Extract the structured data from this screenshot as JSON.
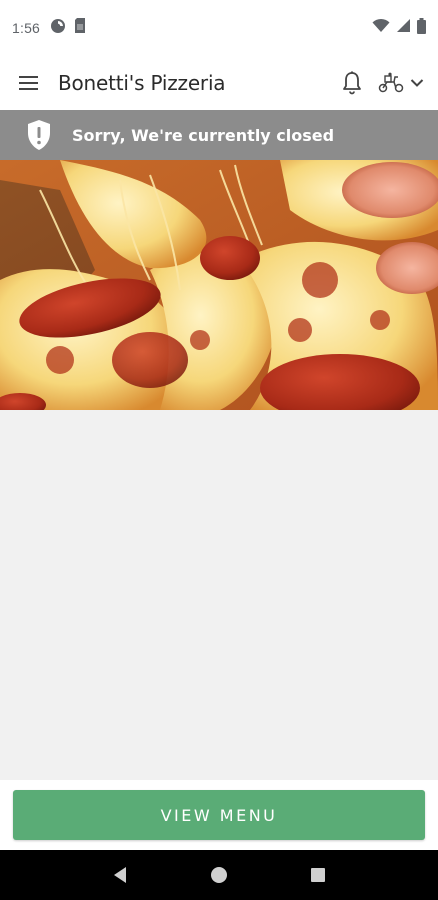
{
  "status_bar": {
    "time": "1:56",
    "left_icons": [
      "data-saver-icon",
      "sim-card-icon"
    ],
    "right_icons": [
      "wifi-icon",
      "cellular-signal-icon",
      "battery-icon"
    ]
  },
  "app_bar": {
    "title": "Bonetti's Pizzeria",
    "icons": [
      "menu-icon",
      "bell-icon",
      "delivery-scooter-icon",
      "chevron-down-icon"
    ]
  },
  "closed_banner": {
    "icon": "shield-alert-icon",
    "text": "Sorry, We're currently closed",
    "background": "#8c8c8c"
  },
  "hero_image": {
    "subject": "pizza-photo"
  },
  "bottom": {
    "view_menu_label": "VIEW MENU",
    "button_color": "#5aac76"
  },
  "nav_bar": {
    "icons": [
      "back-icon",
      "home-icon",
      "recents-icon"
    ]
  }
}
